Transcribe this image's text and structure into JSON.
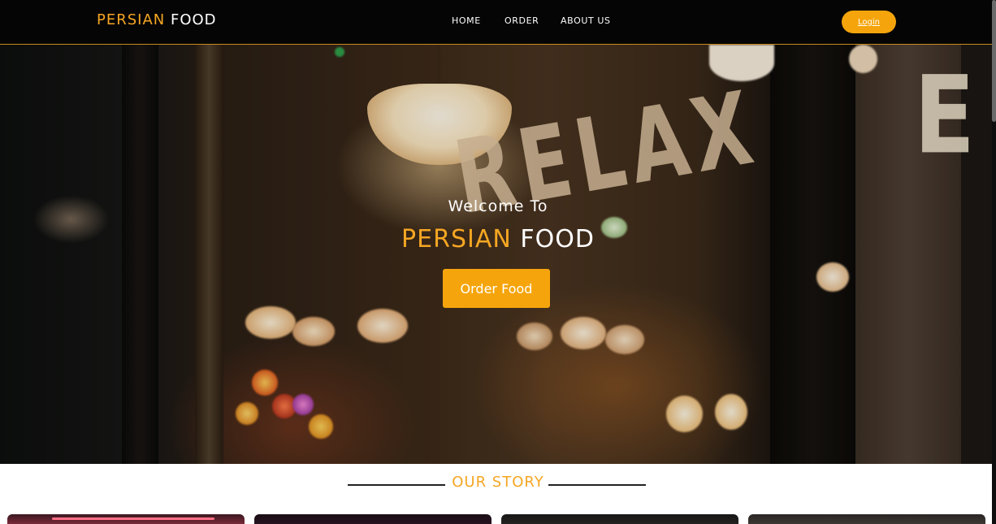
{
  "navbar": {
    "brand": {
      "part1": "PERSIAN",
      "part2": "FOOD"
    },
    "links": [
      {
        "label": "HOME"
      },
      {
        "label": "ORDER"
      },
      {
        "label": "ABOUT US"
      }
    ],
    "login_label": "Login"
  },
  "hero": {
    "welcome": "Welcome To",
    "title": {
      "part1": "PERSIAN",
      "part2": "FOOD"
    },
    "cta_label": "Order Food",
    "sign_text": "RELAX",
    "sign_corner_letter": "E"
  },
  "story": {
    "heading": "OUR STORY"
  },
  "colors": {
    "accent": "#f5a623",
    "button": "#f5a50b",
    "navbar_bg": "#050505"
  }
}
